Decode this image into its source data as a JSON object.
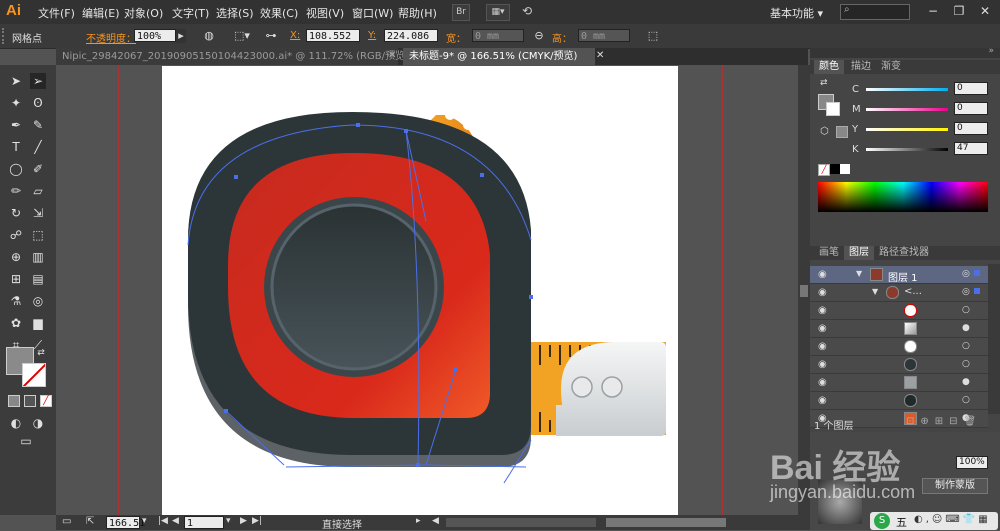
{
  "menubar": {
    "logo": "Ai",
    "items": [
      "文件(F)",
      "编辑(E)",
      "对象(O)",
      "文字(T)",
      "选择(S)",
      "效果(C)",
      "视图(V)",
      "窗口(W)",
      "帮助(H)"
    ],
    "br_label": "Br",
    "workspace": "基本功能"
  },
  "control": {
    "selection_label": "网格点",
    "opacity_label": "不透明度：",
    "opacity_value": "100%",
    "x_label": "X:",
    "x_value": "108.552",
    "y_label": "Y:",
    "y_value": "224.086",
    "w_label": "宽：",
    "w_value": "0 mm",
    "h_label": "高：",
    "h_value": "0 mm"
  },
  "tabs": [
    {
      "label": "Nipic_29842067_20190905150104423000.ai* @ 111.72% (RGB/预览)",
      "active": false
    },
    {
      "label": "未标题-9* @ 166.51% (CMYK/预览)",
      "active": true
    }
  ],
  "status": {
    "zoom": "166.51",
    "page": "1",
    "tool_name": "直接选择"
  },
  "color_panel": {
    "tabs": [
      "颜色",
      "描边",
      "渐变"
    ],
    "channels": [
      {
        "label": "C",
        "value": "0"
      },
      {
        "label": "M",
        "value": "0"
      },
      {
        "label": "Y",
        "value": "0"
      },
      {
        "label": "K",
        "value": "47"
      }
    ]
  },
  "layers_panel": {
    "tabs": [
      "画笔",
      "图层",
      "路径查找器"
    ],
    "layer_name": "图层 1",
    "group_name": "<...",
    "footer_text": "1 个图层"
  },
  "transparency_panel": {
    "opacity_value": "100%",
    "mask_button": "制作蒙版"
  },
  "watermark": {
    "brand": "Bai 经验",
    "url": "jingyan.baidu.com"
  },
  "ime": {
    "label": "五"
  },
  "colors": {
    "accent_orange": "#f7941e",
    "tape_red": "#d9291b",
    "body_dark": "#2c3638",
    "tape_yellow": "#f3a324",
    "guide_red": "#a33"
  }
}
